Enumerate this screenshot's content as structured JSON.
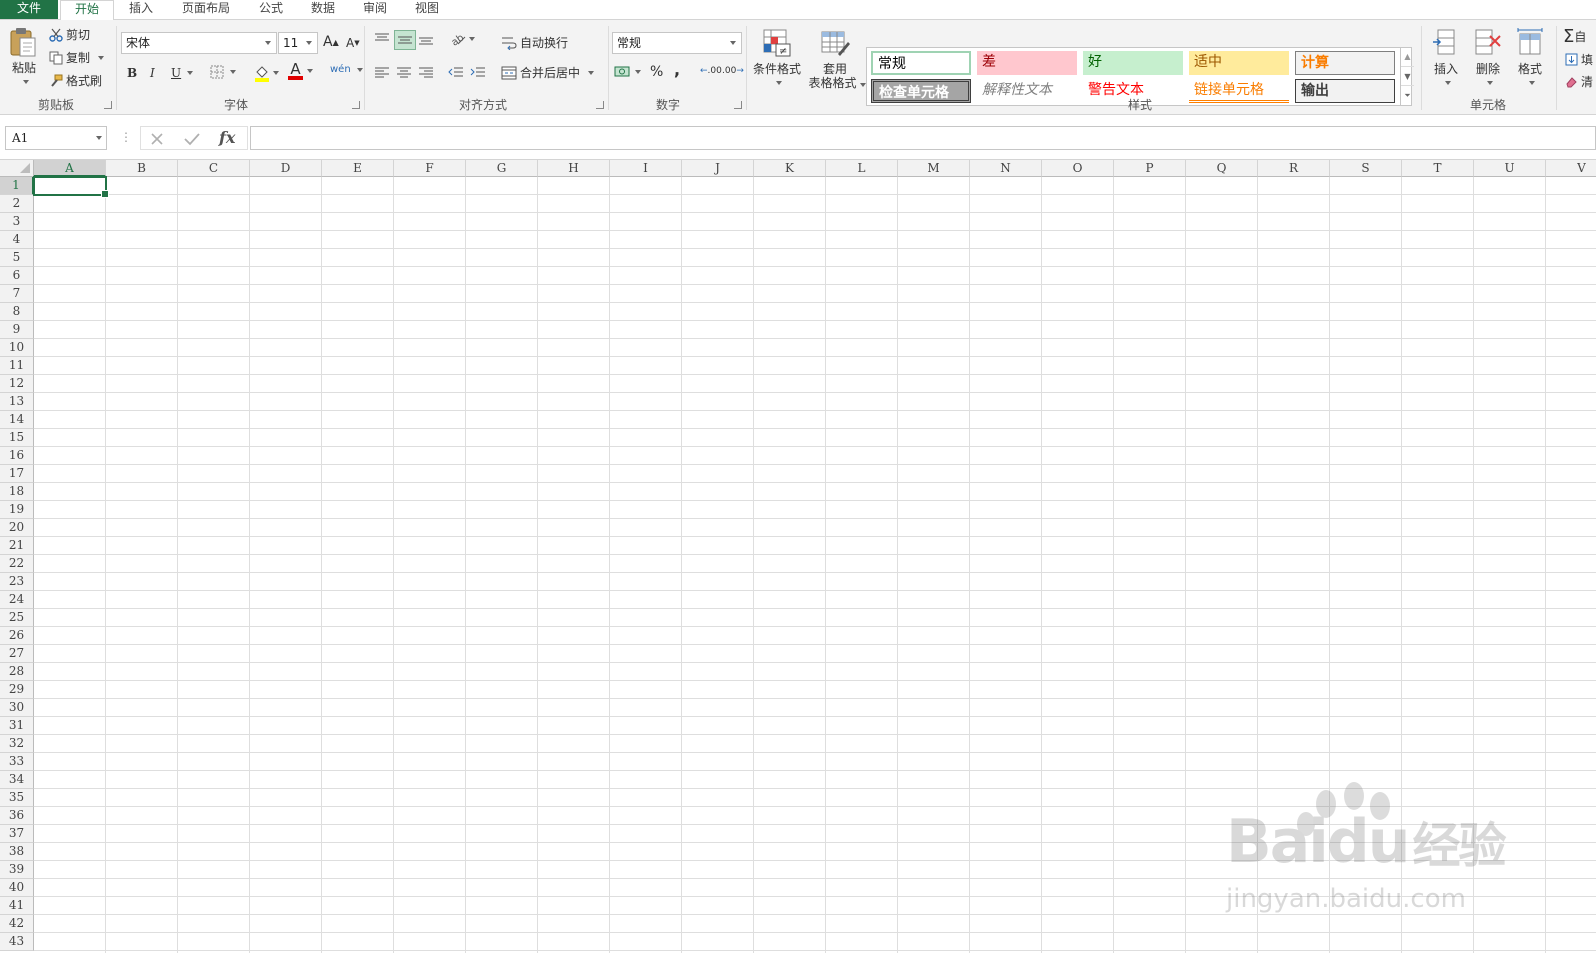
{
  "tabs": [
    {
      "label": "文件"
    },
    {
      "label": "开始"
    },
    {
      "label": "插入"
    },
    {
      "label": "页面布局"
    },
    {
      "label": "公式"
    },
    {
      "label": "数据"
    },
    {
      "label": "审阅"
    },
    {
      "label": "视图"
    }
  ],
  "clipboard": {
    "paste": "粘贴",
    "cut": "剪切",
    "copy": "复制",
    "format_painter": "格式刷",
    "group": "剪贴板"
  },
  "font": {
    "name": "宋体",
    "size": "11",
    "grow": "A",
    "shrink": "A",
    "bold": "B",
    "italic": "I",
    "underline": "U",
    "font_color_glyph": "A",
    "phonetic": "wén",
    "group": "字体"
  },
  "alignment": {
    "wrap_text": "自动换行",
    "merge_center": "合并后居中",
    "group": "对齐方式"
  },
  "number": {
    "format": "常规",
    "percent": "%",
    "comma": ",",
    "inc_decimal": ".00",
    "dec_decimal": ".00",
    "group": "数字"
  },
  "styles": {
    "conditional": "条件格式",
    "table_format_1": "套用",
    "table_format_2": "表格格式",
    "group": "样式",
    "gallery": [
      {
        "label": "常规"
      },
      {
        "label": "差"
      },
      {
        "label": "好"
      },
      {
        "label": "适中"
      },
      {
        "label": "计算"
      },
      {
        "label": "检查单元格"
      },
      {
        "label": "解释性文本"
      },
      {
        "label": "警告文本"
      },
      {
        "label": "链接单元格"
      },
      {
        "label": "输出"
      }
    ]
  },
  "cells_group": {
    "insert": "插入",
    "delete": "删除",
    "format": "格式",
    "group": "单元格"
  },
  "editing": {
    "autosum": "自",
    "fill": "填",
    "clear": "清"
  },
  "formula_bar": {
    "name_box": "A1",
    "fx": "fx",
    "formula": ""
  },
  "columns": [
    "A",
    "B",
    "C",
    "D",
    "E",
    "F",
    "G",
    "H",
    "I",
    "J",
    "K",
    "L",
    "M",
    "N",
    "O",
    "P",
    "Q",
    "R",
    "S",
    "T",
    "U",
    "V"
  ],
  "rows": [
    "1",
    "2",
    "3",
    "4",
    "5",
    "6",
    "7",
    "8",
    "9",
    "10",
    "11",
    "12",
    "13",
    "14",
    "15",
    "16",
    "17",
    "18",
    "19",
    "20",
    "21",
    "22",
    "23",
    "24",
    "25",
    "26",
    "27",
    "28",
    "29",
    "30",
    "31",
    "32",
    "33",
    "34",
    "35",
    "36",
    "37",
    "38",
    "39",
    "40",
    "41",
    "42",
    "43"
  ],
  "watermark": {
    "brand": "Bai",
    "brand2": "du",
    "cn": "经验",
    "url": "jingyan.baidu.com"
  },
  "colors": {
    "accent": "#217346",
    "bad_bg": "#ffc7ce",
    "bad_fg": "#9c0006",
    "good_bg": "#c6efce",
    "good_fg": "#006100",
    "neutral_bg": "#ffeb9c",
    "neutral_fg": "#9c5700",
    "calc_bg": "#f2f2f2",
    "calc_fg": "#fa7d00",
    "check_bg": "#a5a5a5",
    "warn_fg": "#ff0000"
  }
}
